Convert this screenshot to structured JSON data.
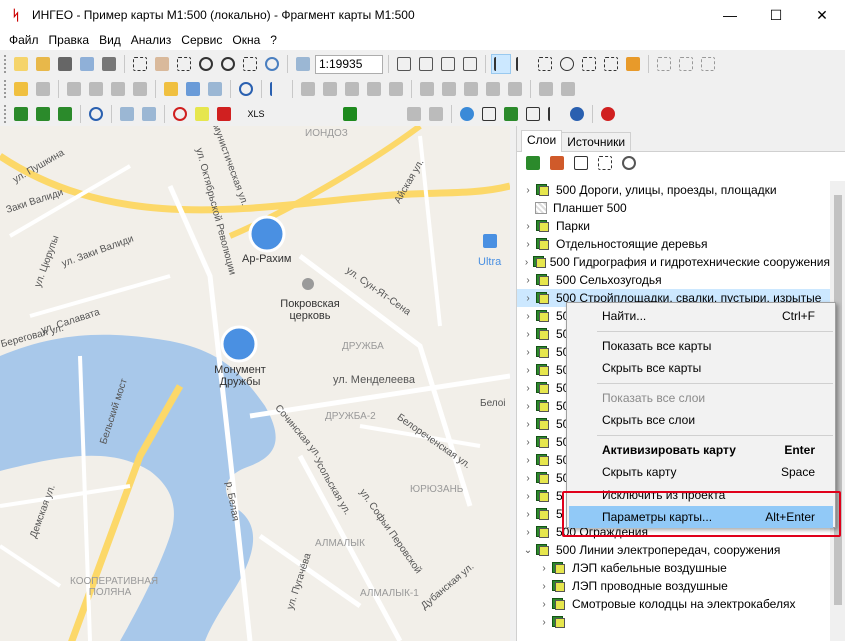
{
  "window": {
    "title": "ИНГЕО - Пример карты М1:500 (локально) - Фрагмент карты М1:500",
    "minimize": "—",
    "maximize": "☐",
    "close": "✕"
  },
  "menu": [
    "Файл",
    "Правка",
    "Вид",
    "Анализ",
    "Сервис",
    "Окна",
    "?"
  ],
  "toolbar": {
    "scale": "1:19935",
    "xls": "XLS"
  },
  "map": {
    "labels": [
      {
        "text": "ул. Пушкина"
      },
      {
        "text": "Заки Валиди"
      },
      {
        "text": "ул. Заки Валиди"
      },
      {
        "text": "ул. Цюрупы"
      },
      {
        "text": "ул. Салавата"
      },
      {
        "text": "ул. Октябрьской Революции"
      },
      {
        "text": "Коммунистическая ул."
      },
      {
        "text": "Ар-Рахим"
      },
      {
        "text": "Покровская церковь"
      },
      {
        "text": "ул. Сун-Ят-Сена"
      },
      {
        "text": "Айская ул."
      },
      {
        "text": "ИОНДОЗ"
      },
      {
        "text": "ДРУЖБА"
      },
      {
        "text": "Монумент Дружбы"
      },
      {
        "text": "ул. Менделеева"
      },
      {
        "text": "ДРУЖБА-2"
      },
      {
        "text": "Сочинская ул."
      },
      {
        "text": "Белореченская ул."
      },
      {
        "text": "Бельский мост"
      },
      {
        "text": "Усольская ул."
      },
      {
        "text": "ул. Софьи Перовской"
      },
      {
        "text": "ЮРЮЗАНЬ"
      },
      {
        "text": "р. Белая"
      },
      {
        "text": "АЛМАЛЫК"
      },
      {
        "text": "ул. Пугачёва"
      },
      {
        "text": "Дубанская ул."
      },
      {
        "text": "АЛМАЛЫК-1"
      },
      {
        "text": "КООПЕРАТИВНАЯ ПОЛЯНА"
      },
      {
        "text": "Демская ул."
      },
      {
        "text": "Береговая ул."
      },
      {
        "text": "Ultra"
      },
      {
        "text": "Белоі"
      }
    ]
  },
  "panel": {
    "tabs": [
      "Слои",
      "Источники"
    ],
    "layers": [
      {
        "label": "500 Дороги, улицы, проезды, площадки",
        "expand": "›",
        "icon": "layer"
      },
      {
        "label": "Планшет 500",
        "expand": "",
        "icon": "grid"
      },
      {
        "label": "Парки",
        "expand": "›",
        "icon": "layer"
      },
      {
        "label": "Отдельностоящие деревья",
        "expand": "›",
        "icon": "layer"
      },
      {
        "label": "500 Гидрография и гидротехнические сооружения",
        "expand": "›",
        "icon": "layer"
      },
      {
        "label": "500 Сельхозугодья",
        "expand": "›",
        "icon": "layer"
      },
      {
        "label": "500 Стройплощадки, свалки, пустыри, изрытые",
        "expand": "›",
        "icon": "layer"
      },
      {
        "label": "500",
        "expand": "›",
        "icon": "layer"
      },
      {
        "label": "500",
        "expand": "›",
        "icon": "layer"
      },
      {
        "label": "500",
        "expand": "›",
        "icon": "layer"
      },
      {
        "label": "500",
        "expand": "›",
        "icon": "layer"
      },
      {
        "label": "500",
        "expand": "›",
        "icon": "layer"
      },
      {
        "label": "500",
        "expand": "›",
        "icon": "layer"
      },
      {
        "label": "500",
        "expand": "›",
        "icon": "layer"
      },
      {
        "label": "500",
        "expand": "›",
        "icon": "layer"
      },
      {
        "label": "500",
        "expand": "›",
        "icon": "layer"
      },
      {
        "label": "500",
        "expand": "›",
        "icon": "layer"
      },
      {
        "label": "5",
        "expand": "›",
        "icon": "layer"
      },
      {
        "label": "5",
        "expand": "›",
        "icon": "layer"
      },
      {
        "label": "500 Ограждения",
        "expand": "›",
        "icon": "layer"
      },
      {
        "label": "500 Линии электропередач, сооружения",
        "expand": "⌄",
        "icon": "layer"
      },
      {
        "label": "ЛЭП кабельные воздушные",
        "expand": "›",
        "icon": "sublayer"
      },
      {
        "label": "ЛЭП проводные воздушные",
        "expand": "›",
        "icon": "sublayer"
      },
      {
        "label": "Смотровые колодцы на электрокабелях",
        "expand": "›",
        "icon": "sublayer"
      },
      {
        "label": "",
        "expand": "›",
        "icon": "sublayer"
      }
    ]
  },
  "context_menu": {
    "items": [
      {
        "label": "Найти...",
        "shortcut": "Ctrl+F",
        "state": ""
      },
      {
        "sep": true
      },
      {
        "label": "Показать все карты",
        "shortcut": "",
        "state": ""
      },
      {
        "label": "Скрыть все карты",
        "shortcut": "",
        "state": ""
      },
      {
        "sep": true
      },
      {
        "label": "Показать все слои",
        "shortcut": "",
        "state": "dis"
      },
      {
        "label": "Скрыть все слои",
        "shortcut": "",
        "state": ""
      },
      {
        "sep": true
      },
      {
        "label": "Активизировать карту",
        "shortcut": "Enter",
        "state": "bold"
      },
      {
        "label": "Скрыть карту",
        "shortcut": "Space",
        "state": ""
      },
      {
        "label": "Исключить из проекта",
        "shortcut": "",
        "state": ""
      },
      {
        "label": "Параметры карты...",
        "shortcut": "Alt+Enter",
        "state": "hl"
      }
    ]
  },
  "colors": {
    "highlight": "#91c9f7",
    "selection_row": "#cce8ff",
    "annotation_box": "#e0001a",
    "river": "#a8c8ea",
    "road": "#fcd869"
  }
}
